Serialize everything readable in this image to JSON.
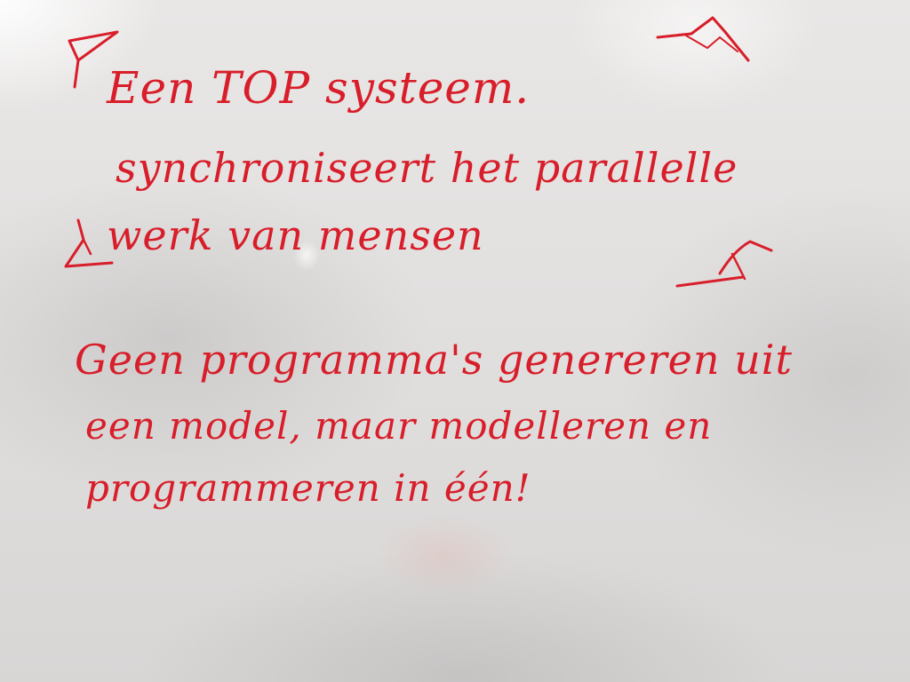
{
  "whiteboard": {
    "ink_color": "#d81e2a",
    "board_color": "#e4e2e1",
    "lines": [
      "Een TOP systeem.",
      "synchroniseert het parallelle",
      "werk van mensen",
      "Geen programma's genereren uit",
      "een model, maar modelleren en",
      "programmeren in één!"
    ],
    "doodles": [
      "flag-sketch",
      "mountain-sketch",
      "tent-sketch",
      "mountain-sketch-small"
    ]
  }
}
